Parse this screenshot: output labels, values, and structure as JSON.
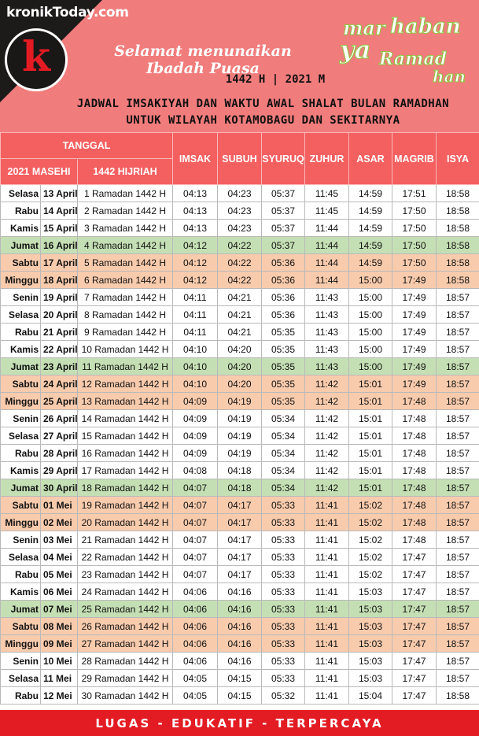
{
  "header": {
    "brand": "kronikToday.com",
    "logo_letter": "k",
    "greeting": "Selamat menunaikan Ibadah Puasa",
    "year": "1442 H | 2021 M",
    "marhaban": [
      "mar",
      "haban",
      "ya",
      "Ramad",
      "han"
    ],
    "title_line1": "JADWAL IMSAKIYAH DAN WAKTU AWAL SHALAT BULAN RAMADHAN",
    "title_line2": "UNTUK WILAYAH KOTAMOBAGU DAN SEKITARNYA"
  },
  "table": {
    "headers": {
      "tanggal": "TANGGAL",
      "masehi": "2021 MASEHI",
      "hijriah": "1442 HIJRIAH",
      "imsak": "IMSAK",
      "subuh": "SUBUH",
      "syuruq": "SYURUQ",
      "zuhur": "ZUHUR",
      "asar": "ASAR",
      "magrib": "MAGRIB",
      "isya": "ISYA"
    },
    "rows": [
      {
        "day": "Selasa",
        "date": "13 April",
        "hijri": "1 Ramadan 1442 H",
        "imsak": "04:13",
        "subuh": "04:23",
        "syuruq": "05:37",
        "zuhur": "11:45",
        "asar": "14:59",
        "magrib": "17:51",
        "isya": "18:58",
        "type": "normal"
      },
      {
        "day": "Rabu",
        "date": "14 April",
        "hijri": "2 Ramadan 1442 H",
        "imsak": "04:13",
        "subuh": "04:23",
        "syuruq": "05:37",
        "zuhur": "11:45",
        "asar": "14:59",
        "magrib": "17:50",
        "isya": "18:58",
        "type": "normal"
      },
      {
        "day": "Kamis",
        "date": "15 April",
        "hijri": "3 Ramadan 1442 H",
        "imsak": "04:13",
        "subuh": "04:23",
        "syuruq": "05:37",
        "zuhur": "11:44",
        "asar": "14:59",
        "magrib": "17:50",
        "isya": "18:58",
        "type": "normal"
      },
      {
        "day": "Jumat",
        "date": "16 April",
        "hijri": "4 Ramadan 1442 H",
        "imsak": "04:12",
        "subuh": "04:22",
        "syuruq": "05:37",
        "zuhur": "11:44",
        "asar": "14:59",
        "magrib": "17:50",
        "isya": "18:58",
        "type": "jumat"
      },
      {
        "day": "Sabtu",
        "date": "17 April",
        "hijri": "5 Ramadan 1442 H",
        "imsak": "04:12",
        "subuh": "04:22",
        "syuruq": "05:36",
        "zuhur": "11:44",
        "asar": "14:59",
        "magrib": "17:50",
        "isya": "18:58",
        "type": "weekend"
      },
      {
        "day": "Minggu",
        "date": "18 April",
        "hijri": "6 Ramadan 1442 H",
        "imsak": "04:12",
        "subuh": "04:22",
        "syuruq": "05:36",
        "zuhur": "11:44",
        "asar": "15:00",
        "magrib": "17:49",
        "isya": "18:58",
        "type": "weekend"
      },
      {
        "day": "Senin",
        "date": "19 April",
        "hijri": "7 Ramadan 1442 H",
        "imsak": "04:11",
        "subuh": "04:21",
        "syuruq": "05:36",
        "zuhur": "11:43",
        "asar": "15:00",
        "magrib": "17:49",
        "isya": "18:57",
        "type": "normal"
      },
      {
        "day": "Selasa",
        "date": "20 April",
        "hijri": "8 Ramadan 1442 H",
        "imsak": "04:11",
        "subuh": "04:21",
        "syuruq": "05:36",
        "zuhur": "11:43",
        "asar": "15:00",
        "magrib": "17:49",
        "isya": "18:57",
        "type": "normal"
      },
      {
        "day": "Rabu",
        "date": "21 April",
        "hijri": "9 Ramadan 1442 H",
        "imsak": "04:11",
        "subuh": "04:21",
        "syuruq": "05:35",
        "zuhur": "11:43",
        "asar": "15:00",
        "magrib": "17:49",
        "isya": "18:57",
        "type": "normal"
      },
      {
        "day": "Kamis",
        "date": "22 April",
        "hijri": "10 Ramadan 1442 H",
        "imsak": "04:10",
        "subuh": "04:20",
        "syuruq": "05:35",
        "zuhur": "11:43",
        "asar": "15:00",
        "magrib": "17:49",
        "isya": "18:57",
        "type": "normal"
      },
      {
        "day": "Jumat",
        "date": "23 April",
        "hijri": "11 Ramadan 1442 H",
        "imsak": "04:10",
        "subuh": "04:20",
        "syuruq": "05:35",
        "zuhur": "11:43",
        "asar": "15:00",
        "magrib": "17:49",
        "isya": "18:57",
        "type": "jumat"
      },
      {
        "day": "Sabtu",
        "date": "24 April",
        "hijri": "12 Ramadan 1442 H",
        "imsak": "04:10",
        "subuh": "04:20",
        "syuruq": "05:35",
        "zuhur": "11:42",
        "asar": "15:01",
        "magrib": "17:49",
        "isya": "18:57",
        "type": "weekend"
      },
      {
        "day": "Minggu",
        "date": "25 April",
        "hijri": "13 Ramadan 1442 H",
        "imsak": "04:09",
        "subuh": "04:19",
        "syuruq": "05:35",
        "zuhur": "11:42",
        "asar": "15:01",
        "magrib": "17:48",
        "isya": "18:57",
        "type": "weekend"
      },
      {
        "day": "Senin",
        "date": "26 April",
        "hijri": "14 Ramadan 1442 H",
        "imsak": "04:09",
        "subuh": "04:19",
        "syuruq": "05:34",
        "zuhur": "11:42",
        "asar": "15:01",
        "magrib": "17:48",
        "isya": "18:57",
        "type": "normal"
      },
      {
        "day": "Selasa",
        "date": "27 April",
        "hijri": "15 Ramadan 1442 H",
        "imsak": "04:09",
        "subuh": "04:19",
        "syuruq": "05:34",
        "zuhur": "11:42",
        "asar": "15:01",
        "magrib": "17:48",
        "isya": "18:57",
        "type": "normal"
      },
      {
        "day": "Rabu",
        "date": "28 April",
        "hijri": "16 Ramadan 1442 H",
        "imsak": "04:09",
        "subuh": "04:19",
        "syuruq": "05:34",
        "zuhur": "11:42",
        "asar": "15:01",
        "magrib": "17:48",
        "isya": "18:57",
        "type": "normal"
      },
      {
        "day": "Kamis",
        "date": "29 April",
        "hijri": "17 Ramadan 1442 H",
        "imsak": "04:08",
        "subuh": "04:18",
        "syuruq": "05:34",
        "zuhur": "11:42",
        "asar": "15:01",
        "magrib": "17:48",
        "isya": "18:57",
        "type": "normal"
      },
      {
        "day": "Jumat",
        "date": "30 April",
        "hijri": "18 Ramadan 1442 H",
        "imsak": "04:07",
        "subuh": "04:18",
        "syuruq": "05:34",
        "zuhur": "11:42",
        "asar": "15:01",
        "magrib": "17:48",
        "isya": "18:57",
        "type": "jumat"
      },
      {
        "day": "Sabtu",
        "date": "01 Mei",
        "hijri": "19 Ramadan 1442 H",
        "imsak": "04:07",
        "subuh": "04:17",
        "syuruq": "05:33",
        "zuhur": "11:41",
        "asar": "15:02",
        "magrib": "17:48",
        "isya": "18:57",
        "type": "weekend"
      },
      {
        "day": "Minggu",
        "date": "02 Mei",
        "hijri": "20 Ramadan 1442 H",
        "imsak": "04:07",
        "subuh": "04:17",
        "syuruq": "05:33",
        "zuhur": "11:41",
        "asar": "15:02",
        "magrib": "17:48",
        "isya": "18:57",
        "type": "weekend"
      },
      {
        "day": "Senin",
        "date": "03 Mei",
        "hijri": "21 Ramadan 1442 H",
        "imsak": "04:07",
        "subuh": "04:17",
        "syuruq": "05:33",
        "zuhur": "11:41",
        "asar": "15:02",
        "magrib": "17:48",
        "isya": "18:57",
        "type": "normal"
      },
      {
        "day": "Selasa",
        "date": "04 Mei",
        "hijri": "22 Ramadan 1442 H",
        "imsak": "04:07",
        "subuh": "04:17",
        "syuruq": "05:33",
        "zuhur": "11:41",
        "asar": "15:02",
        "magrib": "17:47",
        "isya": "18:57",
        "type": "normal"
      },
      {
        "day": "Rabu",
        "date": "05 Mei",
        "hijri": "23 Ramadan 1442 H",
        "imsak": "04:07",
        "subuh": "04:17",
        "syuruq": "05:33",
        "zuhur": "11:41",
        "asar": "15:02",
        "magrib": "17:47",
        "isya": "18:57",
        "type": "normal"
      },
      {
        "day": "Kamis",
        "date": "06 Mei",
        "hijri": "24 Ramadan 1442 H",
        "imsak": "04:06",
        "subuh": "04:16",
        "syuruq": "05:33",
        "zuhur": "11:41",
        "asar": "15:03",
        "magrib": "17:47",
        "isya": "18:57",
        "type": "normal"
      },
      {
        "day": "Jumat",
        "date": "07 Mei",
        "hijri": "25 Ramadan 1442 H",
        "imsak": "04:06",
        "subuh": "04:16",
        "syuruq": "05:33",
        "zuhur": "11:41",
        "asar": "15:03",
        "magrib": "17:47",
        "isya": "18:57",
        "type": "jumat"
      },
      {
        "day": "Sabtu",
        "date": "08 Mei",
        "hijri": "26 Ramadan 1442 H",
        "imsak": "04:06",
        "subuh": "04:16",
        "syuruq": "05:33",
        "zuhur": "11:41",
        "asar": "15:03",
        "magrib": "17:47",
        "isya": "18:57",
        "type": "weekend"
      },
      {
        "day": "Minggu",
        "date": "09 Mei",
        "hijri": "27 Ramadan 1442 H",
        "imsak": "04:06",
        "subuh": "04:16",
        "syuruq": "05:33",
        "zuhur": "11:41",
        "asar": "15:03",
        "magrib": "17:47",
        "isya": "18:57",
        "type": "weekend"
      },
      {
        "day": "Senin",
        "date": "10 Mei",
        "hijri": "28 Ramadan 1442 H",
        "imsak": "04:06",
        "subuh": "04:16",
        "syuruq": "05:33",
        "zuhur": "11:41",
        "asar": "15:03",
        "magrib": "17:47",
        "isya": "18:57",
        "type": "normal"
      },
      {
        "day": "Selasa",
        "date": "11 Mei",
        "hijri": "29 Ramadan 1442 H",
        "imsak": "04:05",
        "subuh": "04:15",
        "syuruq": "05:33",
        "zuhur": "11:41",
        "asar": "15:03",
        "magrib": "17:47",
        "isya": "18:57",
        "type": "normal"
      },
      {
        "day": "Rabu",
        "date": "12 Mei",
        "hijri": "30 Ramadan 1442 H",
        "imsak": "04:05",
        "subuh": "04:15",
        "syuruq": "05:32",
        "zuhur": "11:41",
        "asar": "15:04",
        "magrib": "17:47",
        "isya": "18:58",
        "type": "normal"
      }
    ]
  },
  "footer": {
    "tagline": "LUGAS - EDUKATIF - TERPERCAYA"
  },
  "colors": {
    "header_bg": "#f17c7c",
    "table_header_bg": "#f45f60",
    "jumat_row": "#c5dfb4",
    "weekend_row": "#f8cbad",
    "footer_bg": "#e31b23",
    "marhaban_green": "#8dc63f"
  }
}
